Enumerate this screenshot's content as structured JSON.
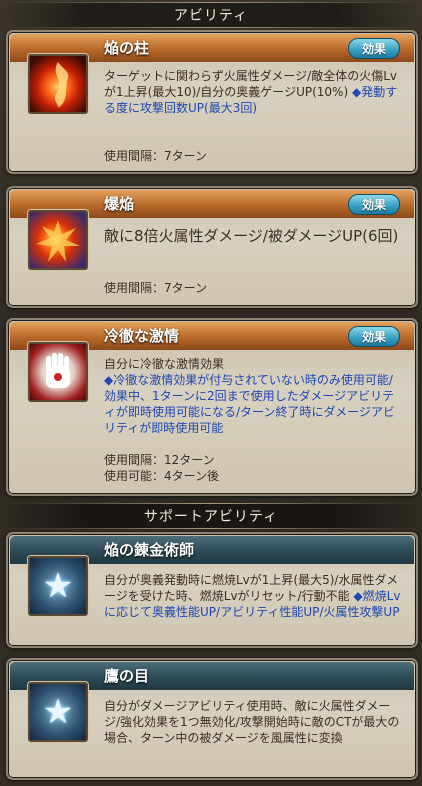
{
  "header": {
    "ability_section": "アビリティ",
    "support_section": "サポートアビリティ"
  },
  "abilities": [
    {
      "name": "焔の柱",
      "badge": "効果",
      "desc": "ターゲットに関わらず火属性ダメージ/敵全体の火傷Lvが1上昇(最大10)/自分の奥義ゲージUP(10%)",
      "desc_blue": "◆発動する度に攻撃回数UP(最大3回)",
      "cooldown": "使用間隔：7ターン",
      "icon": "fire-pillar-icon"
    },
    {
      "name": "爆焔",
      "badge": "効果",
      "desc": "敵に8倍火属性ダメージ/被ダメージUP(6回)",
      "cooldown": "使用間隔：7ターン",
      "icon": "explosion-icon"
    },
    {
      "name": "冷徹な激情",
      "badge": "効果",
      "desc": "自分に冷徹な激情効果",
      "desc_blue": "◆冷徹な激情効果が付与されていない時のみ使用可能/効果中、1ターンに2回まで使用したダメージアビリティが即時使用可能になる/ターン終了時にダメージアビリティが即時使用可能",
      "cooldown": "使用間隔：12ターン",
      "available": "使用可能：4ターン後",
      "icon": "glove-hand-icon"
    }
  ],
  "support": [
    {
      "name": "焔の錬金術師",
      "desc": "自分が奥義発動時に燃焼Lvが1上昇(最大5)/水属性ダメージを受けた時、燃焼Lvがリセット/行動不能",
      "desc_blue": "◆燃焼Lvに応じて奥義性能UP/アビリティ性能UP/火属性攻撃UP",
      "icon": "star-icon"
    },
    {
      "name": "鷹の目",
      "desc": "自分がダメージアビリティ使用時、敵に火属性ダメージ/強化効果を1つ無効化/攻撃開始時に敵のCTが最大の場合、ターン中の被ダメージを風属性に変換",
      "icon": "star-icon"
    }
  ],
  "colors": {
    "accent_blue": "#1e46b4",
    "warning_red": "#e11616",
    "badge": "#3ba2c4"
  }
}
